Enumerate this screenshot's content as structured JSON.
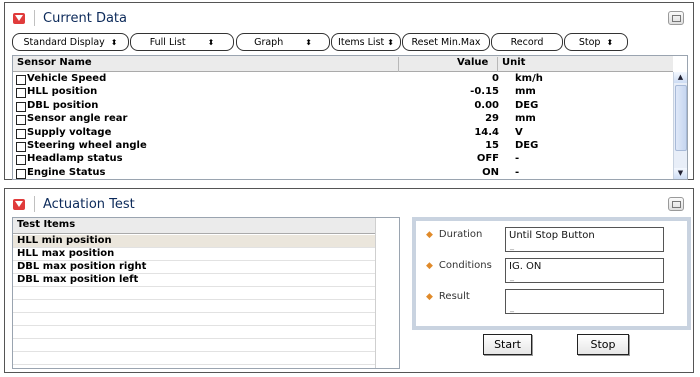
{
  "current_data": {
    "title": "Current Data",
    "toolbar": {
      "standard_display": "Standard Display",
      "full_list": "Full List",
      "graph": "Graph",
      "items_list": "Items List",
      "reset_min_max": "Reset Min.Max",
      "record": "Record",
      "stop": "Stop",
      "arrow_glyph": "⬍"
    },
    "columns": {
      "name": "Sensor Name",
      "value": "Value",
      "unit": "Unit"
    },
    "rows": [
      {
        "name": "Vehicle Speed",
        "value": "0",
        "unit": "km/h"
      },
      {
        "name": "HLL position",
        "value": "-0.15",
        "unit": "mm"
      },
      {
        "name": "DBL position",
        "value": "0.00",
        "unit": "DEG"
      },
      {
        "name": "Sensor angle rear",
        "value": "29",
        "unit": "mm"
      },
      {
        "name": "Supply voltage",
        "value": "14.4",
        "unit": "V"
      },
      {
        "name": "Steering wheel angle",
        "value": "15",
        "unit": "DEG"
      },
      {
        "name": "Headlamp status",
        "value": "OFF",
        "unit": "-"
      },
      {
        "name": "Engine Status",
        "value": "ON",
        "unit": "-"
      }
    ]
  },
  "actuation_test": {
    "title": "Actuation Test",
    "list_header": "Test Items",
    "items": [
      {
        "label": "HLL min position",
        "selected": true
      },
      {
        "label": "HLL max position",
        "selected": false
      },
      {
        "label": "DBL max position right",
        "selected": false
      },
      {
        "label": "DBL max position left",
        "selected": false
      }
    ],
    "duration_label": "Duration",
    "duration_value": "Until Stop Button",
    "conditions_label": "Conditions",
    "conditions_value": "IG. ON",
    "result_label": "Result",
    "result_value": "",
    "start_label": "Start",
    "stop_label": "Stop"
  },
  "colors": {
    "title_icon": "#e03b3b",
    "title_text": "#0c2a5a",
    "selected_row": "#ebe6dc",
    "info_border": "#c9d3e0",
    "bullet": "#e08a2a"
  },
  "icons": {
    "title_icon": "collapse-arrow-icon",
    "window_button": "restore-window-icon",
    "dropdown": "updown-arrow-icon"
  }
}
